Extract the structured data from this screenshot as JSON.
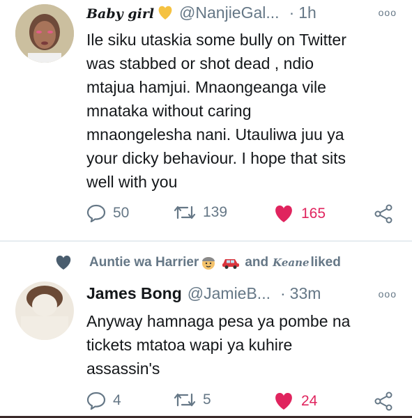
{
  "tweet1": {
    "display_name": "Baby girl",
    "handle": "@NanjieGal...",
    "separator": "·",
    "time": "1h",
    "more": "ooo",
    "body_lines": [
      "Ile siku utaskia some bully on Twitter",
      "was stabbed or shot dead , ndio",
      "mtajua hamjui. Mnaongeanga vile",
      "mnataka without caring",
      "mnaongelesha nani. Utauliwa juu ya",
      "your dicky behaviour. I hope that sits",
      "well with you"
    ],
    "replies": "50",
    "retweets": "139",
    "likes": "165"
  },
  "social_context": {
    "name1": "Auntie wa Harrier",
    "and": "and",
    "name2": "Keane",
    "liked": "liked"
  },
  "tweet2": {
    "display_name": "James Bong",
    "handle": "@JamieB...",
    "separator": "·",
    "time": "33m",
    "more": "ooo",
    "body_lines": [
      "Anyway hamnaga pesa ya pombe na",
      "tickets mtatoa wapi ya kuhire",
      "assassin's"
    ],
    "replies": "4",
    "retweets": "5",
    "likes": "24"
  },
  "colors": {
    "like_red": "#e0245e",
    "secondary_text": "#657786",
    "gold_heart": "#f5c242"
  }
}
